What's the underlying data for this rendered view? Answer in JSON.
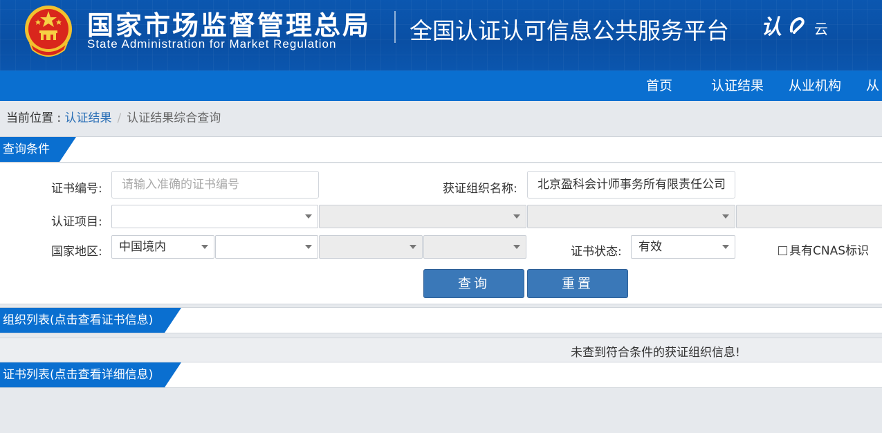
{
  "header": {
    "org_name_cn": "国家市场监督管理总局",
    "org_name_en": "State Administration  for  Market Regulation",
    "platform_title": "全国认证认可信息公共服务平台",
    "logo_main": "认",
    "logo_sub": "云"
  },
  "nav": {
    "items": [
      {
        "label": "首页"
      },
      {
        "label": "认证结果"
      },
      {
        "label": "从业机构"
      },
      {
        "label": "从"
      }
    ]
  },
  "breadcrumb": {
    "prefix": "当前位置 : ",
    "link": "认证结果",
    "separator": "/",
    "current": "认证结果综合查询"
  },
  "query_section": {
    "title": "查询条件",
    "cert_no_label": "证书编号:",
    "cert_no_placeholder": "请输入准确的证书编号",
    "org_name_label": "获证组织名称:",
    "org_name_value": "北京盈科会计师事务所有限责任公司",
    "cert_item_label": "认证项目:",
    "region_label": "国家地区:",
    "region_value": "中国境内",
    "status_label": "证书状态:",
    "status_value": "有效",
    "cnas_label": "具有CNAS标识",
    "search_button": "查询",
    "reset_button": "重置"
  },
  "org_list": {
    "title": "组织列表(点击查看证书信息)",
    "empty_message": "未查到符合条件的获证组织信息!"
  },
  "cert_list": {
    "title": "证书列表(点击查看详细信息)"
  },
  "colors": {
    "header_blue": "#0b57b0",
    "nav_blue": "#0a6fd0",
    "button_blue": "#3a78b8",
    "link_blue": "#2a6fb6"
  }
}
